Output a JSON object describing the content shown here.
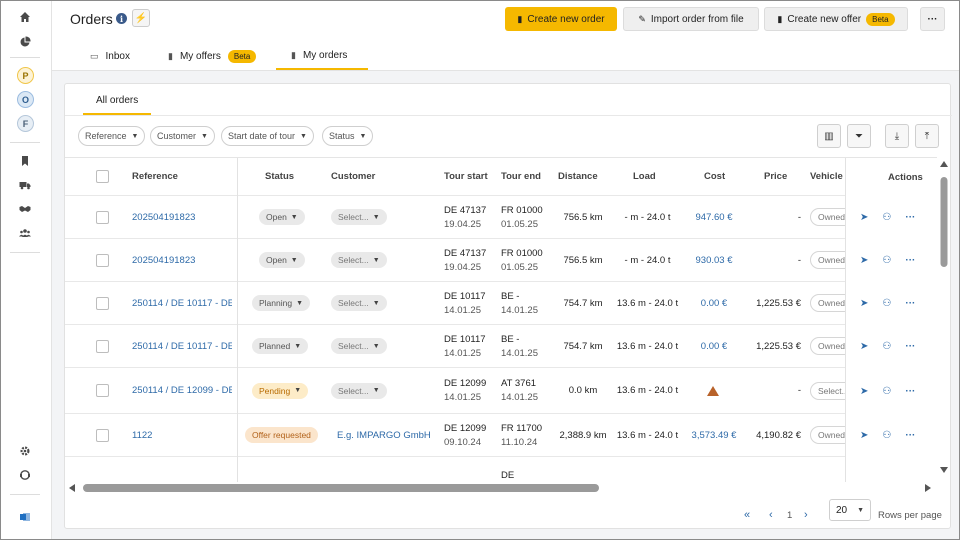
{
  "app": {
    "title": "Orders"
  },
  "sidebar": {
    "circles": [
      {
        "letter": "P",
        "bg": "#fdf3d6",
        "border": "#f0c64a",
        "color": "#9a7300"
      },
      {
        "letter": "O",
        "bg": "#dbe8f5",
        "border": "#9bbce0",
        "color": "#2e5d8f"
      },
      {
        "letter": "F",
        "bg": "#e7eef5",
        "border": "#b5c7da",
        "color": "#4a6077"
      }
    ]
  },
  "header": {
    "create_order": "Create new order",
    "import_order": "Import order from file",
    "create_offer": "Create new offer",
    "beta": "Beta",
    "more": "···"
  },
  "tabs": [
    {
      "label": "Inbox"
    },
    {
      "label": "My offers",
      "badge": "Beta"
    },
    {
      "label": "My orders"
    }
  ],
  "subtabs": {
    "all_orders": "All orders"
  },
  "filters": [
    "Reference",
    "Customer",
    "Start date of tour",
    "Status"
  ],
  "columns": [
    "Reference",
    "Status",
    "Customer",
    "Tour start",
    "Tour end",
    "Distance",
    "Load",
    "Cost",
    "Price",
    "Vehicle",
    "Actions"
  ],
  "rows": [
    {
      "reference": "202504191823",
      "status": "Open",
      "customer": "Select...",
      "start_loc": "DE 47137",
      "start_date": "19.04.25",
      "end_loc": "FR 01000",
      "end_date": "01.05.25",
      "distance": "756.5 km",
      "load": "- m - 24.0 t",
      "cost": "947.60 €",
      "price": "-",
      "vehicle": "Owned"
    },
    {
      "reference": "202504191823",
      "status": "Open",
      "customer": "Select...",
      "start_loc": "DE 47137",
      "start_date": "19.04.25",
      "end_loc": "FR 01000",
      "end_date": "01.05.25",
      "distance": "756.5 km",
      "load": "- m - 24.0 t",
      "cost": "930.03 €",
      "price": "-",
      "vehicle": "Owned"
    },
    {
      "reference": "250114 / DE 10117 - DE",
      "status": "Planning",
      "customer": "Select...",
      "start_loc": "DE 10117",
      "start_date": "14.01.25",
      "end_loc": "BE -",
      "end_date": "14.01.25",
      "distance": "754.7 km",
      "load": "13.6 m - 24.0 t",
      "cost": "0.00 €",
      "price": "1,225.53 €",
      "vehicle": "Owned"
    },
    {
      "reference": "250114 / DE 10117 - DE",
      "status": "Planned",
      "customer": "Select...",
      "start_loc": "DE 10117",
      "start_date": "14.01.25",
      "end_loc": "BE -",
      "end_date": "14.01.25",
      "distance": "754.7 km",
      "load": "13.6 m - 24.0 t",
      "cost": "0.00 €",
      "price": "1,225.53 €",
      "vehicle": "Owned"
    },
    {
      "reference": "250114 / DE 12099 - DE",
      "status": "Pending",
      "customer": "Select...",
      "start_loc": "DE 12099",
      "start_date": "14.01.25",
      "end_loc": "AT 3761",
      "end_date": "14.01.25",
      "distance": "0.0 km",
      "load": "13.6 m - 24.0 t",
      "cost": "",
      "price": "-",
      "vehicle": "Select..."
    },
    {
      "reference": "1122",
      "status": "Offer requested",
      "customer": "E.g. IMPARGO GmbH",
      "start_loc": "DE 12099",
      "start_date": "09.10.24",
      "end_loc": "FR 11700",
      "end_date": "11.10.24",
      "distance": "2,388.9 km",
      "load": "13.6 m - 24.0 t",
      "cost": "3,573.49 €",
      "price": "4,190.82 €",
      "vehicle": "Owned"
    },
    {
      "reference": "",
      "status": "",
      "customer": "",
      "start_loc": "",
      "start_date": "",
      "end_loc": "DE",
      "end_date": "",
      "distance": "",
      "load": "",
      "cost": "",
      "price": "",
      "vehicle": ""
    }
  ],
  "pagination": {
    "current_page": "1",
    "rows_per_page": "20",
    "rows_per_page_label": "Rows per page"
  },
  "colors": {
    "accent": "#f5b800",
    "link": "#2e6aa8",
    "warning": "#b8622a"
  }
}
